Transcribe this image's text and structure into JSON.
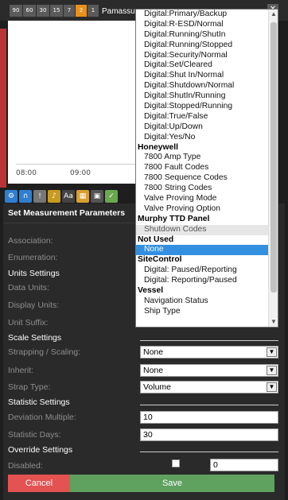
{
  "toolbar": {
    "time_buttons": [
      "90",
      "60",
      "30",
      "15",
      "7",
      "2",
      "1"
    ],
    "active_time_button": "2",
    "title": "Pamassus",
    "close_glyph": "✕"
  },
  "chart": {
    "x_ticks": [
      "08:00",
      "09:00"
    ]
  },
  "panel": {
    "title": "Set Measurement Parameters",
    "labels": {
      "association": "Association:",
      "enumeration": "Enumeration:",
      "units_settings": "Units Settings",
      "data_units": "Data Units:",
      "display_units": "Display Units:",
      "unit_suffix": "Unit Suffix:",
      "scale_settings": "Scale Settings",
      "strapping": "Strapping / Scaling:",
      "inherit": "Inherit:",
      "strap_type": "Strap Type:",
      "statistic_settings": "Statistic Settings",
      "deviation_multiple": "Deviation Multiple:",
      "statistic_days": "Statistic Days:",
      "override_settings": "Override Settings",
      "disabled": "Disabled:"
    },
    "values": {
      "strapping": "None",
      "inherit": "None",
      "strap_type": "Volume",
      "deviation_multiple": "10",
      "statistic_days": "30",
      "disabled_value": "0"
    },
    "buttons": {
      "cancel": "Cancel",
      "save": "Save"
    }
  },
  "dropdown": {
    "rows": [
      {
        "type": "item",
        "text": "Digital:Primary/Backup"
      },
      {
        "type": "item",
        "text": "Digital:R-ESD/Normal"
      },
      {
        "type": "item",
        "text": "Digital:Running/ShutIn"
      },
      {
        "type": "item",
        "text": "Digital:Running/Stopped"
      },
      {
        "type": "item",
        "text": "Digital:Security/Normal"
      },
      {
        "type": "item",
        "text": "Digital:Set/Cleared"
      },
      {
        "type": "item",
        "text": "Digital:Shut In/Normal"
      },
      {
        "type": "item",
        "text": "Digital:Shutdown/Normal"
      },
      {
        "type": "item",
        "text": "Digital:ShutIn/Running"
      },
      {
        "type": "item",
        "text": "Digital:Stopped/Running"
      },
      {
        "type": "item",
        "text": "Digital:True/False"
      },
      {
        "type": "item",
        "text": "Digital:Up/Down"
      },
      {
        "type": "item",
        "text": "Digital:Yes/No"
      },
      {
        "type": "group",
        "text": "Honeywell"
      },
      {
        "type": "item",
        "text": "7800 Amp Type"
      },
      {
        "type": "item",
        "text": "7800 Fault Codes"
      },
      {
        "type": "item",
        "text": "7800 Sequence Codes"
      },
      {
        "type": "item",
        "text": "7800 String Codes"
      },
      {
        "type": "item",
        "text": "Valve Proving Mode"
      },
      {
        "type": "item",
        "text": "Valve Proving Option"
      },
      {
        "type": "group",
        "text": "Murphy TTD Panel"
      },
      {
        "type": "item",
        "text": "Shutdown Codes",
        "state": "hover"
      },
      {
        "type": "group",
        "text": "Not Used"
      },
      {
        "type": "item",
        "text": "None",
        "state": "selected"
      },
      {
        "type": "group",
        "text": "SiteControl"
      },
      {
        "type": "item",
        "text": "Digital: Paused/Reporting"
      },
      {
        "type": "item",
        "text": "Digital: Reporting/Paused"
      },
      {
        "type": "group",
        "text": "Vessel"
      },
      {
        "type": "item",
        "text": "Navigation Status"
      },
      {
        "type": "item",
        "text": "Ship Type"
      }
    ]
  },
  "colors": {
    "active_chip": "#e8901d",
    "selected_row": "#3390e0",
    "cancel": "#e45252",
    "save": "#5fa15f"
  }
}
